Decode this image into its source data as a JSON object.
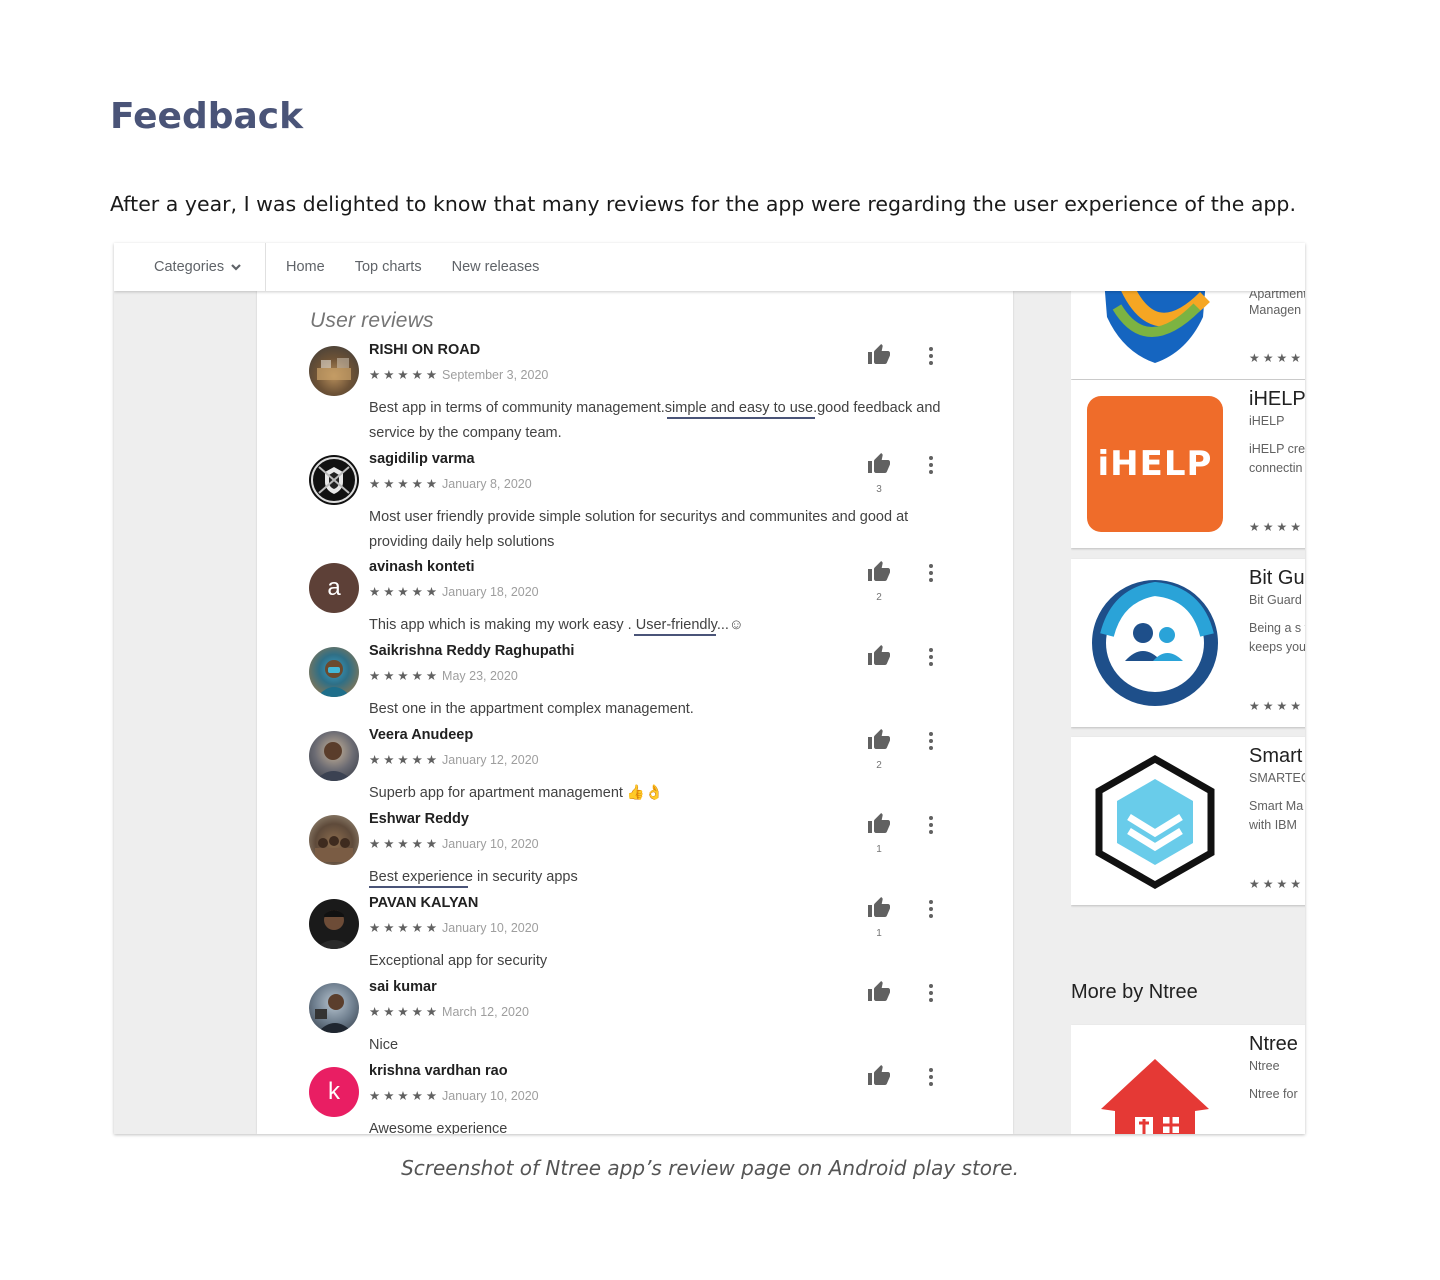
{
  "page": {
    "title": "Feedback",
    "intro": "After a year, I was delighted to know that many reviews for the app were regarding the user experience of the app.",
    "caption": "Screenshot of Ntree app’s review page on Android play store."
  },
  "nav": {
    "categories": "Categories",
    "links": [
      "Home",
      "Top charts",
      "New releases"
    ]
  },
  "reviews": {
    "heading": "User reviews",
    "stars": "★★★★★",
    "items": [
      {
        "name": "RISHI ON ROAD",
        "date": "September 3, 2020",
        "text": "Best app in terms of community management.simple and easy to use.good feedback and service by the company team.",
        "likes": ""
      },
      {
        "name": "sagidilip varma",
        "date": "January 8, 2020",
        "text": "Most user friendly provide simple solution for securitys and communites and good at providing daily help solutions",
        "likes": "3"
      },
      {
        "name": "avinash konteti",
        "date": "January 18, 2020",
        "text": "This app which is making my work easy . User-friendly...☺",
        "likes": "2",
        "initial": "a"
      },
      {
        "name": "Saikrishna Reddy Raghupathi",
        "date": "May 23, 2020",
        "text": "Best one in the appartment complex management.",
        "likes": ""
      },
      {
        "name": "Veera Anudeep",
        "date": "January 12, 2020",
        "text": "Superb app for apartment management 👍👌",
        "likes": "2"
      },
      {
        "name": "Eshwar Reddy",
        "date": "January 10, 2020",
        "text": "Best experience in security apps",
        "likes": "1"
      },
      {
        "name": "PAVAN KALYAN",
        "date": "January 10, 2020",
        "text": "Exceptional app for security",
        "likes": "1"
      },
      {
        "name": "sai kumar",
        "date": "March 12, 2020",
        "text": "Nice",
        "likes": ""
      },
      {
        "name": "krishna vardhan rao",
        "date": "January 10, 2020",
        "text": "Awesome experience",
        "likes": "",
        "initial": "k"
      }
    ]
  },
  "similar_apps": [
    {
      "title": "",
      "developer": "Apartment",
      "description": "Managen",
      "stars": "★★★★"
    },
    {
      "title": "iHELP",
      "developer": "iHELP",
      "description": "iHELP cre emergenc connectin",
      "stars": "★★★★",
      "icon_text": "iHELP"
    },
    {
      "title": "Bit Gu",
      "developer": "Bit Guard",
      "description": "Being a s this parer keeps you",
      "stars": "★★★★"
    },
    {
      "title": "Smart",
      "developer": "SMARTEC",
      "description": "Smart Ma allows de with IBM",
      "stars": "★★★★"
    }
  ],
  "more_by": {
    "heading": "More by Ntree",
    "app": {
      "title": "Ntree",
      "developer": "Ntree",
      "description": "Ntree for"
    }
  },
  "colors": {
    "title": "#4a5478",
    "underline": "#4a5478",
    "ihelp_orange": "#ef6c2a",
    "avatar_a": "#5d4037",
    "avatar_k": "#e91e63",
    "ntree_red": "#e53935"
  }
}
